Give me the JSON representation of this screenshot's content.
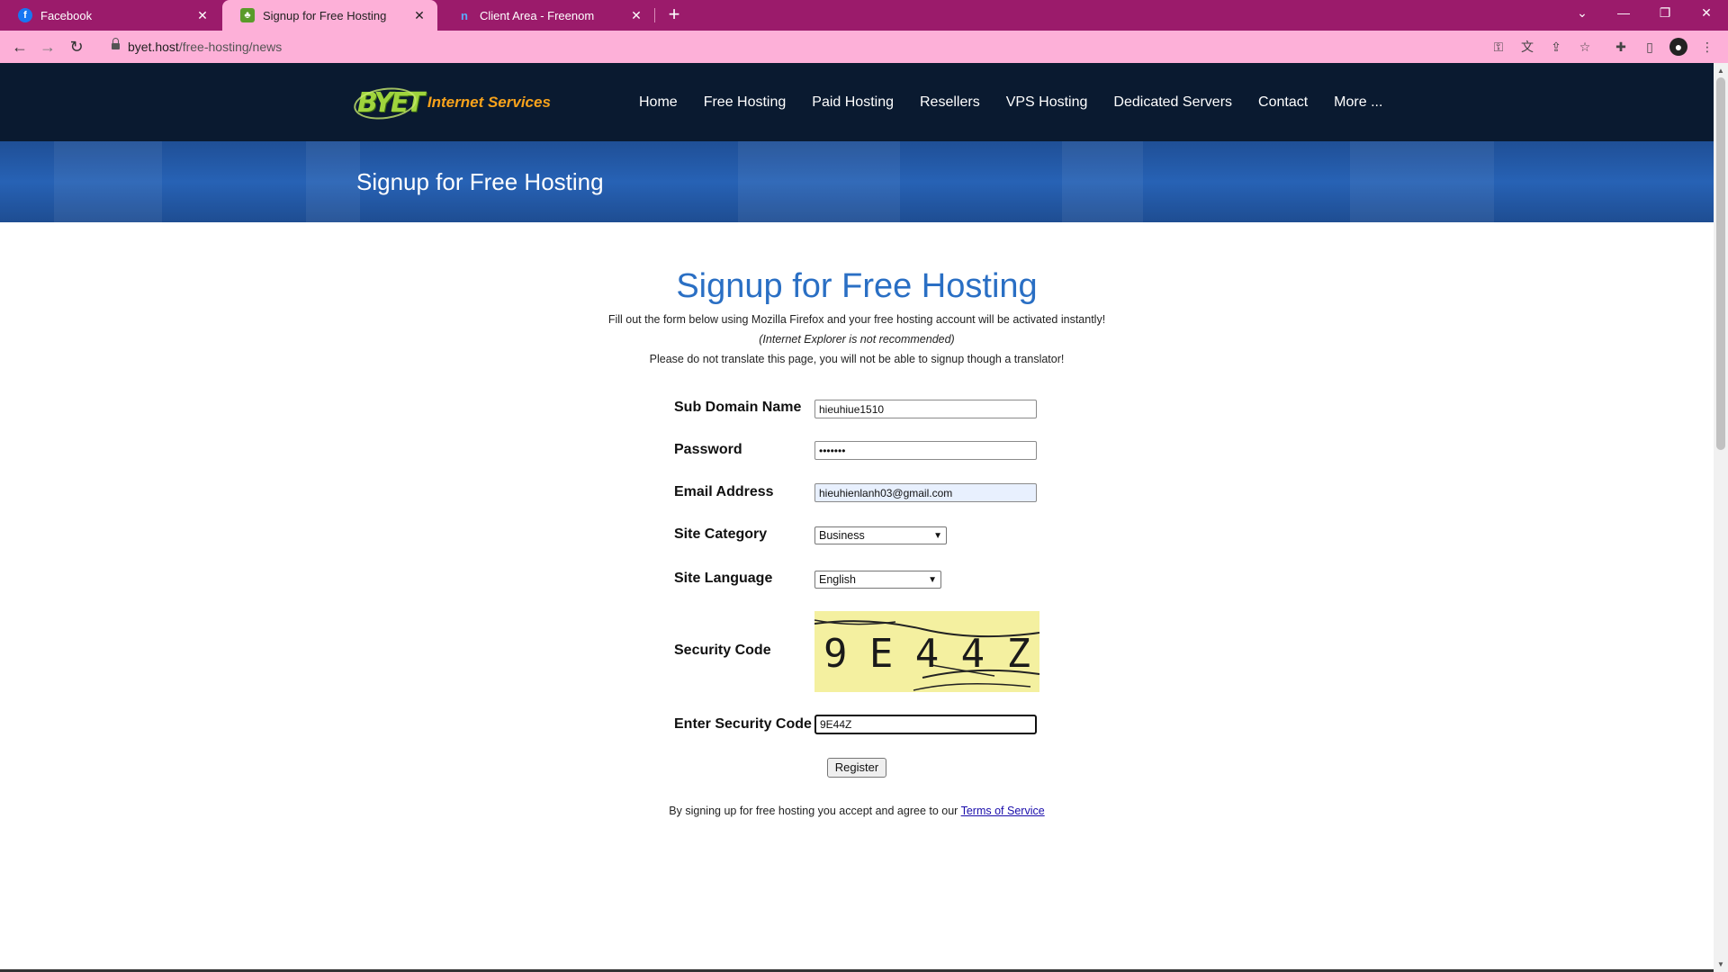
{
  "browser": {
    "tabs": [
      {
        "title": "Facebook",
        "icon": "facebook-icon",
        "active": false
      },
      {
        "title": "Signup for Free Hosting",
        "icon": "byet-leaf-icon",
        "active": true
      },
      {
        "title": "Client Area - Freenom",
        "icon": "freenom-icon",
        "active": false
      }
    ],
    "url_host": "byet.host",
    "url_path": "/free-hosting/news",
    "accent_color": "#9b1b6b",
    "toolbar_color": "#fdb0d8"
  },
  "site": {
    "logo_badge": "BYET",
    "logo_text": "Internet Services",
    "menu": [
      "Home",
      "Free Hosting",
      "Paid Hosting",
      "Resellers",
      "VPS Hosting",
      "Dedicated Servers",
      "Contact",
      "More ..."
    ],
    "banner_title": "Signup for Free Hosting"
  },
  "form": {
    "heading": "Signup for Free Hosting",
    "intro_1": "Fill out the form below using Mozilla Firefox and your free hosting account will be activated instantly!",
    "intro_2": "(Internet Explorer is not recommended)",
    "intro_3": "Please do not translate this page, you will not be able to signup though a translator!",
    "subdomain_label": "Sub Domain Name",
    "subdomain_value": "hieuhiue1510",
    "password_label": "Password",
    "password_value": "•••••••",
    "email_label": "Email Address",
    "email_value": "hieuhienlanh03@gmail.com",
    "category_label": "Site Category",
    "category_value": "Business",
    "language_label": "Site Language",
    "language_value": "English",
    "security_label": "Security Code",
    "captcha_text": "9 E 4 4 Z",
    "enter_security_label": "Enter Security Code",
    "enter_security_value": "9E44Z",
    "register_label": "Register",
    "tos_prefix": "By signing up for free hosting you accept and agree to our",
    "tos_link": "Terms of Service"
  }
}
